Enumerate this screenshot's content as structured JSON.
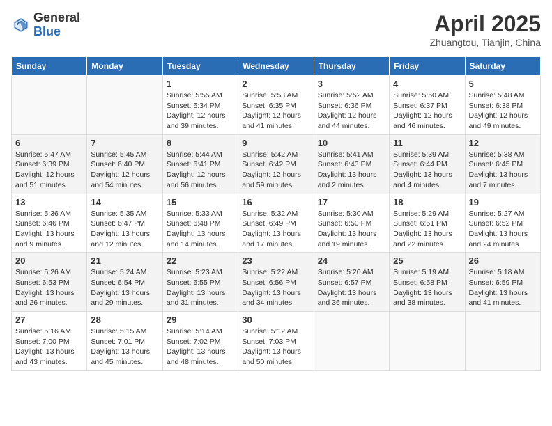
{
  "header": {
    "logo_general": "General",
    "logo_blue": "Blue",
    "title": "April 2025",
    "location": "Zhuangtou, Tianjin, China"
  },
  "weekdays": [
    "Sunday",
    "Monday",
    "Tuesday",
    "Wednesday",
    "Thursday",
    "Friday",
    "Saturday"
  ],
  "weeks": [
    [
      {
        "day": "",
        "info": ""
      },
      {
        "day": "",
        "info": ""
      },
      {
        "day": "1",
        "info": "Sunrise: 5:55 AM\nSunset: 6:34 PM\nDaylight: 12 hours and 39 minutes."
      },
      {
        "day": "2",
        "info": "Sunrise: 5:53 AM\nSunset: 6:35 PM\nDaylight: 12 hours and 41 minutes."
      },
      {
        "day": "3",
        "info": "Sunrise: 5:52 AM\nSunset: 6:36 PM\nDaylight: 12 hours and 44 minutes."
      },
      {
        "day": "4",
        "info": "Sunrise: 5:50 AM\nSunset: 6:37 PM\nDaylight: 12 hours and 46 minutes."
      },
      {
        "day": "5",
        "info": "Sunrise: 5:48 AM\nSunset: 6:38 PM\nDaylight: 12 hours and 49 minutes."
      }
    ],
    [
      {
        "day": "6",
        "info": "Sunrise: 5:47 AM\nSunset: 6:39 PM\nDaylight: 12 hours and 51 minutes."
      },
      {
        "day": "7",
        "info": "Sunrise: 5:45 AM\nSunset: 6:40 PM\nDaylight: 12 hours and 54 minutes."
      },
      {
        "day": "8",
        "info": "Sunrise: 5:44 AM\nSunset: 6:41 PM\nDaylight: 12 hours and 56 minutes."
      },
      {
        "day": "9",
        "info": "Sunrise: 5:42 AM\nSunset: 6:42 PM\nDaylight: 12 hours and 59 minutes."
      },
      {
        "day": "10",
        "info": "Sunrise: 5:41 AM\nSunset: 6:43 PM\nDaylight: 13 hours and 2 minutes."
      },
      {
        "day": "11",
        "info": "Sunrise: 5:39 AM\nSunset: 6:44 PM\nDaylight: 13 hours and 4 minutes."
      },
      {
        "day": "12",
        "info": "Sunrise: 5:38 AM\nSunset: 6:45 PM\nDaylight: 13 hours and 7 minutes."
      }
    ],
    [
      {
        "day": "13",
        "info": "Sunrise: 5:36 AM\nSunset: 6:46 PM\nDaylight: 13 hours and 9 minutes."
      },
      {
        "day": "14",
        "info": "Sunrise: 5:35 AM\nSunset: 6:47 PM\nDaylight: 13 hours and 12 minutes."
      },
      {
        "day": "15",
        "info": "Sunrise: 5:33 AM\nSunset: 6:48 PM\nDaylight: 13 hours and 14 minutes."
      },
      {
        "day": "16",
        "info": "Sunrise: 5:32 AM\nSunset: 6:49 PM\nDaylight: 13 hours and 17 minutes."
      },
      {
        "day": "17",
        "info": "Sunrise: 5:30 AM\nSunset: 6:50 PM\nDaylight: 13 hours and 19 minutes."
      },
      {
        "day": "18",
        "info": "Sunrise: 5:29 AM\nSunset: 6:51 PM\nDaylight: 13 hours and 22 minutes."
      },
      {
        "day": "19",
        "info": "Sunrise: 5:27 AM\nSunset: 6:52 PM\nDaylight: 13 hours and 24 minutes."
      }
    ],
    [
      {
        "day": "20",
        "info": "Sunrise: 5:26 AM\nSunset: 6:53 PM\nDaylight: 13 hours and 26 minutes."
      },
      {
        "day": "21",
        "info": "Sunrise: 5:24 AM\nSunset: 6:54 PM\nDaylight: 13 hours and 29 minutes."
      },
      {
        "day": "22",
        "info": "Sunrise: 5:23 AM\nSunset: 6:55 PM\nDaylight: 13 hours and 31 minutes."
      },
      {
        "day": "23",
        "info": "Sunrise: 5:22 AM\nSunset: 6:56 PM\nDaylight: 13 hours and 34 minutes."
      },
      {
        "day": "24",
        "info": "Sunrise: 5:20 AM\nSunset: 6:57 PM\nDaylight: 13 hours and 36 minutes."
      },
      {
        "day": "25",
        "info": "Sunrise: 5:19 AM\nSunset: 6:58 PM\nDaylight: 13 hours and 38 minutes."
      },
      {
        "day": "26",
        "info": "Sunrise: 5:18 AM\nSunset: 6:59 PM\nDaylight: 13 hours and 41 minutes."
      }
    ],
    [
      {
        "day": "27",
        "info": "Sunrise: 5:16 AM\nSunset: 7:00 PM\nDaylight: 13 hours and 43 minutes."
      },
      {
        "day": "28",
        "info": "Sunrise: 5:15 AM\nSunset: 7:01 PM\nDaylight: 13 hours and 45 minutes."
      },
      {
        "day": "29",
        "info": "Sunrise: 5:14 AM\nSunset: 7:02 PM\nDaylight: 13 hours and 48 minutes."
      },
      {
        "day": "30",
        "info": "Sunrise: 5:12 AM\nSunset: 7:03 PM\nDaylight: 13 hours and 50 minutes."
      },
      {
        "day": "",
        "info": ""
      },
      {
        "day": "",
        "info": ""
      },
      {
        "day": "",
        "info": ""
      }
    ]
  ]
}
